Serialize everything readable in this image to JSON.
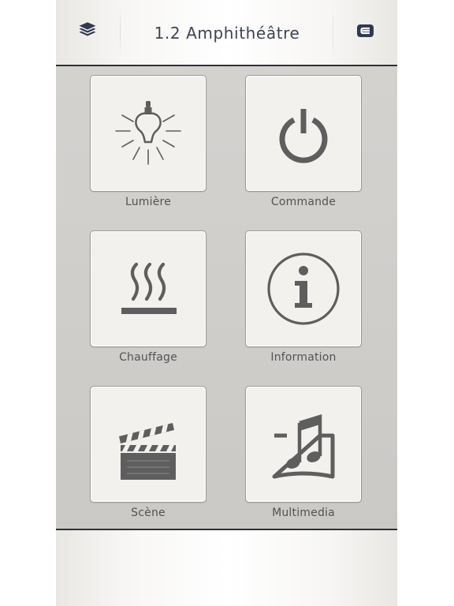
{
  "header": {
    "title": "1.2 Amphithéâtre",
    "left_icon": "layers-icon",
    "right_icon": "logout-icon"
  },
  "tiles": [
    {
      "label": "Lumière",
      "icon": "light-bulb-icon"
    },
    {
      "label": "Commande",
      "icon": "power-icon"
    },
    {
      "label": "Chauffage",
      "icon": "heating-icon"
    },
    {
      "label": "Information",
      "icon": "info-icon"
    },
    {
      "label": "Scène",
      "icon": "clapperboard-icon"
    },
    {
      "label": "Multimedia",
      "icon": "music-screen-icon"
    }
  ],
  "colors": {
    "icon": "#5e5e5e",
    "title": "#3d4351",
    "header_icon": "#2f3a4f",
    "panel_border": "#2e3138"
  }
}
